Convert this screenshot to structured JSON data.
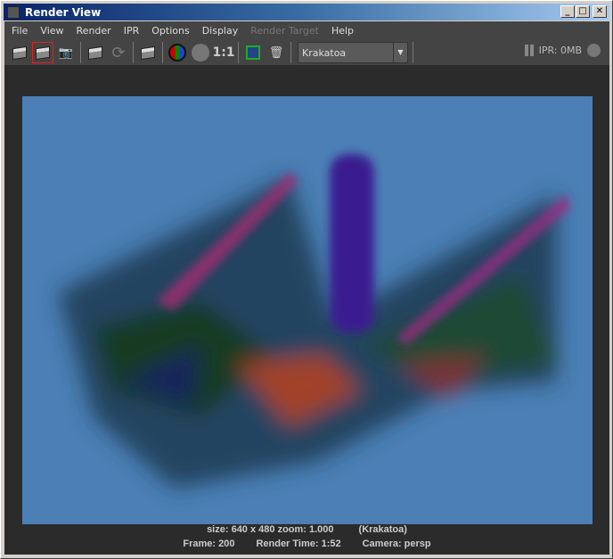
{
  "window": {
    "title": "Render View"
  },
  "menu": [
    "File",
    "View",
    "Render",
    "IPR",
    "Options",
    "Display",
    "Render Target",
    "Help"
  ],
  "toolbar": {
    "ratio_label": "1:1",
    "renderer": "Krakatoa",
    "ipr_status": "IPR: 0MB"
  },
  "status": {
    "size": "size: 640 x 480 zoom: 1.000",
    "renderer": "(Krakatoa)",
    "frame": "Frame: 200",
    "render_time": "Render Time:  1:52",
    "camera": "Camera: persp"
  }
}
